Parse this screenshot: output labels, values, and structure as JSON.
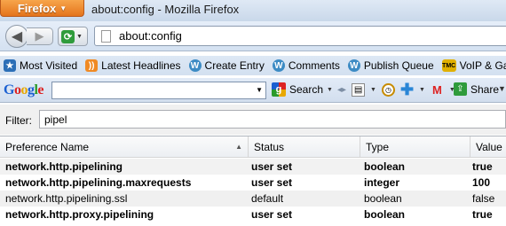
{
  "window": {
    "app_button": "Firefox",
    "title": "about:config - Mozilla Firefox"
  },
  "nav": {
    "url": "about:config"
  },
  "bookmarks": [
    {
      "label": "Most Visited",
      "icon": "most-visited-icon"
    },
    {
      "label": "Latest Headlines",
      "icon": "rss-icon"
    },
    {
      "label": "Create Entry",
      "icon": "wordpress-icon"
    },
    {
      "label": "Comments",
      "icon": "wordpress-icon"
    },
    {
      "label": "Publish Queue",
      "icon": "wordpress-icon"
    },
    {
      "label": "VoIP & Gac",
      "icon": "tmc-icon"
    }
  ],
  "google_toolbar": {
    "logo": "Google",
    "search_value": "",
    "search_button": "Search",
    "share_label": "Share"
  },
  "filter": {
    "label": "Filter:",
    "value": "pipel"
  },
  "table": {
    "headers": {
      "name": "Preference Name",
      "status": "Status",
      "type": "Type",
      "value": "Value"
    },
    "rows": [
      {
        "name": "network.http.pipelining",
        "status": "user set",
        "type": "boolean",
        "value": "true",
        "modified": true
      },
      {
        "name": "network.http.pipelining.maxrequests",
        "status": "user set",
        "type": "integer",
        "value": "100",
        "modified": true
      },
      {
        "name": "network.http.pipelining.ssl",
        "status": "default",
        "type": "boolean",
        "value": "false",
        "modified": false
      },
      {
        "name": "network.http.proxy.pipelining",
        "status": "user set",
        "type": "boolean",
        "value": "true",
        "modified": true
      }
    ]
  }
}
